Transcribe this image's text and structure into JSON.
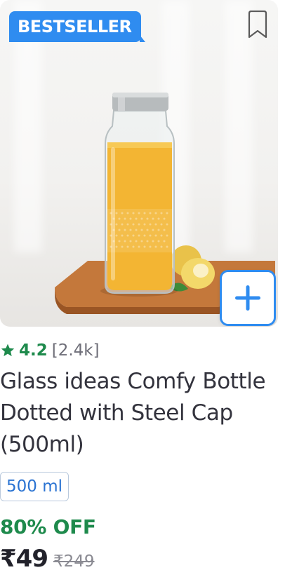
{
  "badge": {
    "label": "BESTSELLER"
  },
  "product": {
    "image_alt": "Glass bottle with orange juice on wooden board",
    "rating": {
      "value": "4.2",
      "count": "[2.4k]"
    },
    "title": "Glass ideas Comfy Bottle Dotted with Steel Cap (500ml)",
    "variant": "500 ml",
    "discount": "80% OFF",
    "price": "₹49",
    "mrp": "₹249"
  },
  "icons": {
    "bookmark": "bookmark-icon",
    "add": "plus-icon",
    "star": "star-icon"
  },
  "colors": {
    "accent_blue": "#2f8cf0",
    "rating_green": "#1e8a4c",
    "variant_text": "#2a73d2"
  }
}
